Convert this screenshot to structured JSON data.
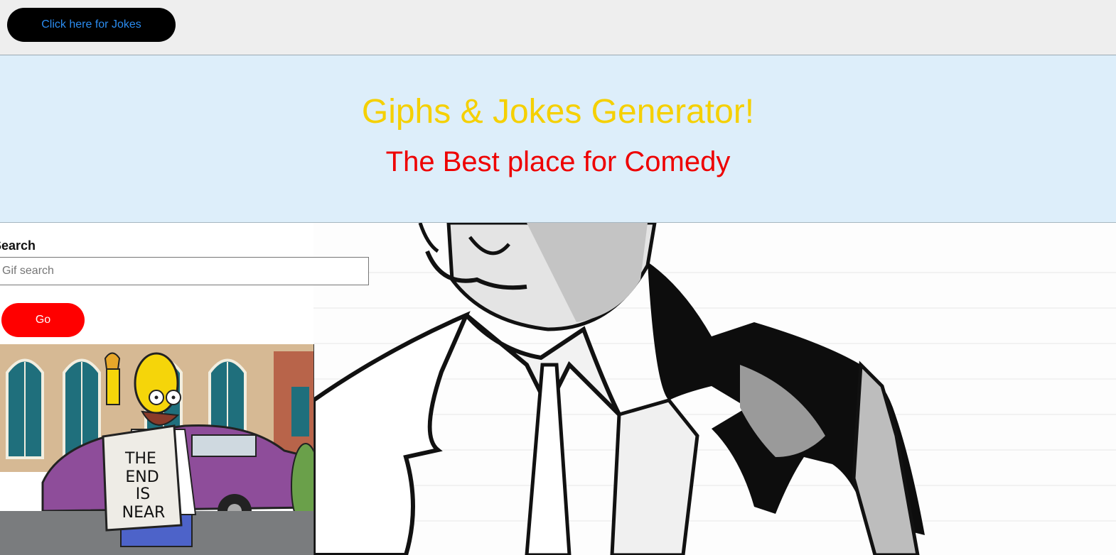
{
  "nav": {
    "jokes_button_label": "Click here for Jokes"
  },
  "hero": {
    "title": "Giphs & Jokes Generator!",
    "subtitle": "The Best place for Comedy"
  },
  "search": {
    "label": "Search",
    "placeholder": "Gif search",
    "value": "",
    "go_label": "Go"
  },
  "gif": {
    "sign_text": "THE END IS NEAR"
  },
  "colors": {
    "title": "#f5d000",
    "subtitle": "#ee0000",
    "hero_bg": "#ddeefa",
    "go_button": "#ff0000",
    "jokes_button_bg": "#000000",
    "jokes_button_text": "#2b8cf0"
  }
}
